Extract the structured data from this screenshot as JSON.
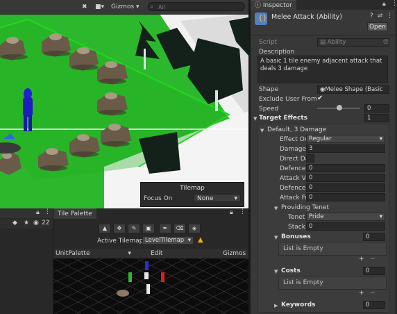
{
  "scene": {
    "toolbar": {
      "gizmos_label": "Gizmos",
      "search_placeholder": "All"
    },
    "tilemap_overlay": {
      "title": "Tilemap",
      "focus_label": "Focus On",
      "focus_value": "None"
    }
  },
  "left_panel": {
    "hidden_count": "22"
  },
  "tile_palette": {
    "tab_label": "Tile Palette",
    "active_tilemap_label": "Active Tilemap",
    "active_tilemap_value": "LevelTilemap",
    "palette_name": "UnitPalette",
    "edit_label": "Edit",
    "gizmos_label": "Gizmos"
  },
  "inspector": {
    "tab_label": "Inspector",
    "object_title": "Melee Attack (Ability)",
    "open_label": "Open",
    "script_label": "Script",
    "script_value": "Ability",
    "description_label": "Description",
    "description_text": "A basic 1 tile enemy adjacent attack that deals 3 damage",
    "shape_label": "Shape",
    "shape_value": "Melee Shape (Basic",
    "exclude_label": "Exclude User From T",
    "speed_label": "Speed",
    "speed_value": "0",
    "target_effects_label": "Target Effects",
    "target_effects_count": "1",
    "effect_header": "Default, 3 Damage",
    "fields": [
      {
        "label": "Effect Or",
        "value": "Regular",
        "kind": "dropdown"
      },
      {
        "label": "Damage",
        "value": "3",
        "kind": "field"
      },
      {
        "label": "Direct Da",
        "value": "",
        "kind": "checkbox"
      },
      {
        "label": "Defence",
        "value": "0",
        "kind": "field"
      },
      {
        "label": "Attack Va",
        "value": "0",
        "kind": "field"
      },
      {
        "label": "Defence",
        "value": "0",
        "kind": "field"
      },
      {
        "label": "Attack Fr",
        "value": "0",
        "kind": "field"
      }
    ],
    "providing_tenet_label": "Providing Tenet",
    "tenet_label": "Tenet",
    "tenet_value": "Pride",
    "stack_label": "Stack",
    "stack_value": "0",
    "bonuses_label": "Bonuses",
    "bonuses_count": "0",
    "bonuses_empty": "List is Empty",
    "costs_label": "Costs",
    "costs_count": "0",
    "costs_empty": "List is Empty",
    "keywords_label": "Keywords",
    "keywords_count": "0"
  },
  "colors": {
    "scene_grass": "#28b428",
    "tilemap_outline": "#22e022",
    "unit_blue": "#2222cc",
    "inspector_bg": "#383838"
  }
}
